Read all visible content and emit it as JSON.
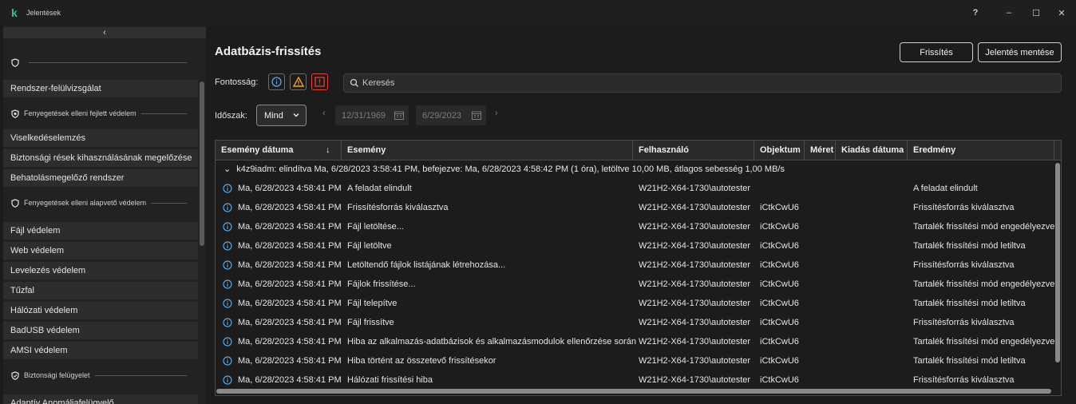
{
  "window": {
    "title": "Jelentések",
    "help": "?",
    "minimize": "–",
    "maximize": "☐",
    "close": "✕"
  },
  "sidebar": {
    "collapse_glyph": "‹",
    "top_section": "",
    "items_a": [
      {
        "label": "Rendszer-felülvizsgálat"
      }
    ],
    "section_advanced": "Fenyegetések elleni fejlett védelem",
    "items_b": [
      {
        "label": "Viselkedéselemzés"
      },
      {
        "label": "Biztonsági rések kihasználásának megelőzése"
      },
      {
        "label": "Behatolásmegelőző rendszer"
      }
    ],
    "section_basic": "Fenyegetések elleni alapvető védelem",
    "items_c": [
      {
        "label": "Fájl védelem"
      },
      {
        "label": "Web védelem"
      },
      {
        "label": "Levelezés védelem"
      },
      {
        "label": "Tűzfal"
      },
      {
        "label": "Hálózati védelem"
      },
      {
        "label": "BadUSB védelem"
      },
      {
        "label": "AMSI védelem"
      }
    ],
    "section_monitor": "Biztonsági felügyelet",
    "items_d": [
      {
        "label": "Adaptív Anomáliafelügyelő"
      }
    ]
  },
  "main": {
    "title": "Adatbázis-frissítés",
    "update_button": "Frissítés",
    "save_report_button": "Jelentés mentése",
    "severity_label": "Fontosság:",
    "search_placeholder": "Keresés",
    "period_label": "Időszak:",
    "period_value": "Mind",
    "date_from": "12/31/1969",
    "date_to": "6/29/2023"
  },
  "colors": {
    "accent_green": "#2fc57f",
    "info_blue": "#5aa7e8",
    "warning_orange": "#f1a21d",
    "critical_red": "#e0413a"
  },
  "table": {
    "headers": {
      "date": "Esemény dátuma",
      "sort_glyph": "↓",
      "event": "Esemény",
      "user": "Felhasználó",
      "object": "Objektum",
      "size": "Méret",
      "release_date": "Kiadás dátuma",
      "result": "Eredmény"
    },
    "group": {
      "expand_glyph": "⌄",
      "text": "k4z9iadm: elindítva Ma, 6/28/2023 3:58:41 PM, befejezve: Ma, 6/28/2023 4:58:42 PM (1 óra), letöltve 10,00 MB, átlagos sebesség 1,00 MB/s"
    },
    "rows": [
      {
        "date": "Ma, 6/28/2023 4:58:41 PM",
        "event": "A feladat elindult",
        "user": "W21H2-X64-1730\\autotester",
        "object": "",
        "result": "A feladat elindult"
      },
      {
        "date": "Ma, 6/28/2023 4:58:41 PM",
        "event": "Frissítésforrás kiválasztva",
        "user": "W21H2-X64-1730\\autotester",
        "object": "iCtkCwU6",
        "result": "Frissítésforrás kiválasztva"
      },
      {
        "date": "Ma, 6/28/2023 4:58:41 PM",
        "event": "Fájl letöltése...",
        "user": "W21H2-X64-1730\\autotester",
        "object": "iCtkCwU6",
        "result": "Tartalék frissítési mód engedélyezve"
      },
      {
        "date": "Ma, 6/28/2023 4:58:41 PM",
        "event": "Fájl letöltve",
        "user": "W21H2-X64-1730\\autotester",
        "object": "iCtkCwU6",
        "result": "Tartalék frissítési mód letiltva"
      },
      {
        "date": "Ma, 6/28/2023 4:58:41 PM",
        "event": "Letöltendő fájlok listájának létrehozása...",
        "user": "W21H2-X64-1730\\autotester",
        "object": "iCtkCwU6",
        "result": "Frissítésforrás kiválasztva"
      },
      {
        "date": "Ma, 6/28/2023 4:58:41 PM",
        "event": "Fájlok frissítése...",
        "user": "W21H2-X64-1730\\autotester",
        "object": "iCtkCwU6",
        "result": "Tartalék frissítési mód engedélyezve"
      },
      {
        "date": "Ma, 6/28/2023 4:58:41 PM",
        "event": "Fájl telepítve",
        "user": "W21H2-X64-1730\\autotester",
        "object": "iCtkCwU6",
        "result": "Tartalék frissítési mód letiltva"
      },
      {
        "date": "Ma, 6/28/2023 4:58:41 PM",
        "event": "Fájl frissítve",
        "user": "W21H2-X64-1730\\autotester",
        "object": "iCtkCwU6",
        "result": "Frissítésforrás kiválasztva"
      },
      {
        "date": "Ma, 6/28/2023 4:58:41 PM",
        "event": "Hiba az alkalmazás-adatbázisok és alkalmazásmodulok ellenőrzése során",
        "user": "W21H2-X64-1730\\autotester",
        "object": "iCtkCwU6",
        "result": "Tartalék frissítési mód engedélyezve"
      },
      {
        "date": "Ma, 6/28/2023 4:58:41 PM",
        "event": "Hiba történt az összetevő frissítésekor",
        "user": "W21H2-X64-1730\\autotester",
        "object": "iCtkCwU6",
        "result": "Tartalék frissítési mód letiltva"
      },
      {
        "date": "Ma, 6/28/2023 4:58:41 PM",
        "event": "Hálózati frissítési hiba",
        "user": "W21H2-X64-1730\\autotester",
        "object": "iCtkCwU6",
        "result": "Frissítésforrás kiválasztva"
      }
    ]
  }
}
